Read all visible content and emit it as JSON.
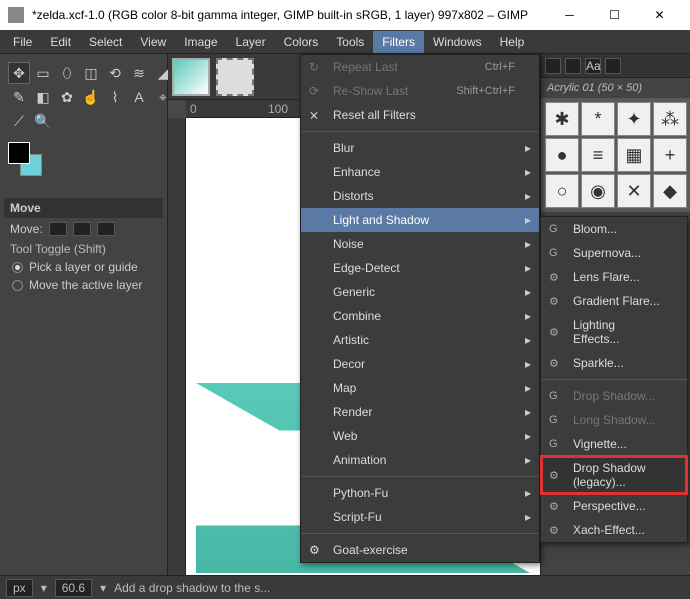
{
  "window": {
    "title": "*zelda.xcf-1.0 (RGB color 8-bit gamma integer, GIMP built-in sRGB, 1 layer) 997x802 – GIMP"
  },
  "menubar": [
    "File",
    "Edit",
    "Select",
    "View",
    "Image",
    "Layer",
    "Colors",
    "Tools",
    "Filters",
    "Windows",
    "Help"
  ],
  "menubar_active": "Filters",
  "toolopts": {
    "title": "Move",
    "label": "Move:",
    "toggle_label": "Tool Toggle  (Shift)",
    "radio1": "Pick a layer or guide",
    "radio2": "Move the active layer"
  },
  "ruler": {
    "t0": "0",
    "t1": "100"
  },
  "brush": {
    "label": "Acrylic 01 (50 × 50)"
  },
  "filters_menu": {
    "repeat": "Repeat Last",
    "repeat_sc": "Ctrl+F",
    "reshow": "Re-Show Last",
    "reshow_sc": "Shift+Ctrl+F",
    "reset": "Reset all Filters",
    "groups": [
      "Blur",
      "Enhance",
      "Distorts",
      "Light and Shadow",
      "Noise",
      "Edge-Detect",
      "Generic",
      "Combine",
      "Artistic",
      "Decor",
      "Map",
      "Render",
      "Web",
      "Animation"
    ],
    "python": "Python-Fu",
    "script": "Script-Fu",
    "goat": "Goat-exercise"
  },
  "ls_menu": {
    "bloom": "Bloom...",
    "supernova": "Supernova...",
    "lensflare": "Lens Flare...",
    "gradflare": "Gradient Flare...",
    "lighting": "Lighting Effects...",
    "sparkle": "Sparkle...",
    "dropshadow": "Drop Shadow...",
    "longshadow": "Long Shadow...",
    "vignette": "Vignette...",
    "dropshadow_legacy": "Drop Shadow (legacy)...",
    "perspective": "Perspective...",
    "xach": "Xach-Effect..."
  },
  "status": {
    "unit": "px",
    "zoom": "60.6",
    "msg": "Add a drop shadow to the s..."
  }
}
